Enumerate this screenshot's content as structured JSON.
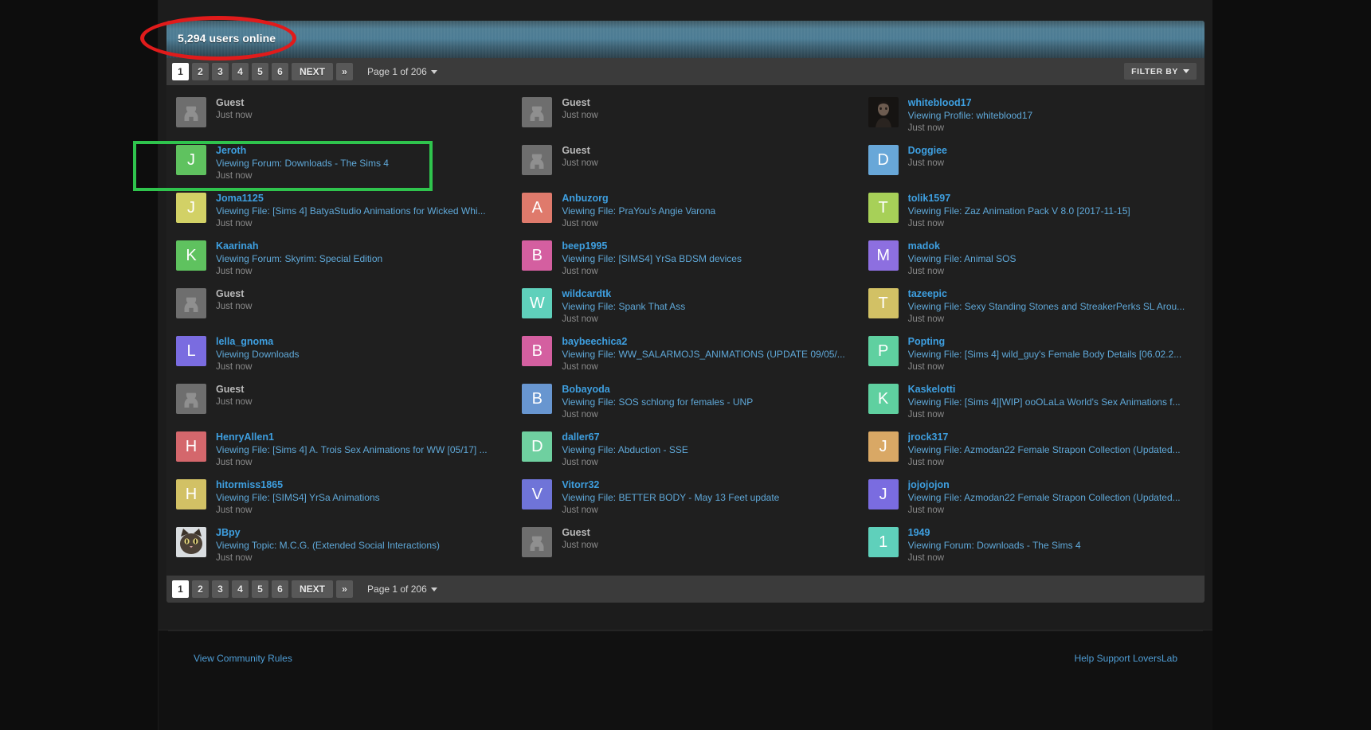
{
  "header": {
    "title": "5,294 users online"
  },
  "pagination": {
    "pages": [
      "1",
      "2",
      "3",
      "4",
      "5",
      "6"
    ],
    "active_page": "1",
    "next_label": "NEXT",
    "last_label": "»",
    "page_label": "Page 1 of 206",
    "filter_label": "FILTER BY"
  },
  "footer": {
    "left_link": "View Community Rules",
    "right_link": "Help Support LoversLab"
  },
  "colors": {
    "accent_link": "#3e9fe0",
    "header_gradient_top": "#4f7d93",
    "annotation_red": "#e01b1b",
    "annotation_green": "#2fc44d"
  },
  "users": [
    {
      "name": "Guest",
      "activity": "",
      "time": "Just now",
      "avatar_type": "guest",
      "avatar_letter": "",
      "avatar_color": "#6e6e6e",
      "is_guest": true
    },
    {
      "name": "Guest",
      "activity": "",
      "time": "Just now",
      "avatar_type": "guest",
      "avatar_letter": "",
      "avatar_color": "#6e6e6e",
      "is_guest": true
    },
    {
      "name": "whiteblood17",
      "activity": "Viewing Profile: whiteblood17",
      "time": "Just now",
      "avatar_type": "photo",
      "avatar_letter": "",
      "avatar_color": "#2b2b2b",
      "is_guest": false
    },
    {
      "name": "Jeroth",
      "activity": "Viewing Forum: Downloads - The Sims 4",
      "time": "Just now",
      "avatar_type": "letter",
      "avatar_letter": "J",
      "avatar_color": "#5fc25f",
      "is_guest": false
    },
    {
      "name": "Guest",
      "activity": "",
      "time": "Just now",
      "avatar_type": "guest",
      "avatar_letter": "",
      "avatar_color": "#6e6e6e",
      "is_guest": true
    },
    {
      "name": "Doggiee",
      "activity": "",
      "time": "Just now",
      "avatar_type": "letter",
      "avatar_letter": "D",
      "avatar_color": "#68a7d8",
      "is_guest": false
    },
    {
      "name": "Joma1125",
      "activity": "Viewing File: [Sims 4] BatyaStudio Animations for Wicked Whi...",
      "time": "Just now",
      "avatar_type": "letter",
      "avatar_letter": "J",
      "avatar_color": "#d2d166",
      "is_guest": false
    },
    {
      "name": "Anbuzorg",
      "activity": "Viewing File: PraYou's Angie Varona",
      "time": "Just now",
      "avatar_type": "letter",
      "avatar_letter": "A",
      "avatar_color": "#df7a6c",
      "is_guest": false
    },
    {
      "name": "tolik1597",
      "activity": "Viewing File: Zaz Animation Pack V 8.0 [2017-11-15]",
      "time": "Just now",
      "avatar_type": "letter",
      "avatar_letter": "T",
      "avatar_color": "#a7d058",
      "is_guest": false
    },
    {
      "name": "Kaarinah",
      "activity": "Viewing Forum: Skyrim: Special Edition",
      "time": "Just now",
      "avatar_type": "letter",
      "avatar_letter": "K",
      "avatar_color": "#5fc25f",
      "is_guest": false
    },
    {
      "name": "beep1995",
      "activity": "Viewing File: [SIMS4] YrSa BDSM devices",
      "time": "Just now",
      "avatar_type": "letter",
      "avatar_letter": "B",
      "avatar_color": "#d45fa0",
      "is_guest": false
    },
    {
      "name": "madok",
      "activity": "Viewing File: Animal SOS",
      "time": "Just now",
      "avatar_type": "letter",
      "avatar_letter": "M",
      "avatar_color": "#8d6fe0",
      "is_guest": false
    },
    {
      "name": "Guest",
      "activity": "",
      "time": "Just now",
      "avatar_type": "guest",
      "avatar_letter": "",
      "avatar_color": "#6e6e6e",
      "is_guest": true
    },
    {
      "name": "wildcardtk",
      "activity": "Viewing File: Spank That Ass",
      "time": "Just now",
      "avatar_type": "letter",
      "avatar_letter": "W",
      "avatar_color": "#5fd0bb",
      "is_guest": false
    },
    {
      "name": "tazeepic",
      "activity": "Viewing File: Sexy Standing Stones and StreakerPerks SL Arou...",
      "time": "Just now",
      "avatar_type": "letter",
      "avatar_letter": "T",
      "avatar_color": "#d2c165",
      "is_guest": false
    },
    {
      "name": "lella_gnoma",
      "activity": "Viewing Downloads",
      "time": "Just now",
      "avatar_type": "letter",
      "avatar_letter": "L",
      "avatar_color": "#7a6ce0",
      "is_guest": false
    },
    {
      "name": "baybeechica2",
      "activity": "Viewing File: WW_SALARMOJS_ANIMATIONS (UPDATE 09/05/...",
      "time": "Just now",
      "avatar_type": "letter",
      "avatar_letter": "B",
      "avatar_color": "#d45fa0",
      "is_guest": false
    },
    {
      "name": "Popting",
      "activity": "Viewing File: [Sims 4] wild_guy's Female Body Details [06.02.2...",
      "time": "Just now",
      "avatar_type": "letter",
      "avatar_letter": "P",
      "avatar_color": "#5fd0a0",
      "is_guest": false
    },
    {
      "name": "Guest",
      "activity": "",
      "time": "Just now",
      "avatar_type": "guest",
      "avatar_letter": "",
      "avatar_color": "#6e6e6e",
      "is_guest": true
    },
    {
      "name": "Bobayoda",
      "activity": "Viewing File: SOS schlong for females - UNP",
      "time": "Just now",
      "avatar_type": "letter",
      "avatar_letter": "B",
      "avatar_color": "#6896d0",
      "is_guest": false
    },
    {
      "name": "Kaskelotti",
      "activity": "Viewing File: [Sims 4][WIP] ooOLaLa World's Sex Animations f...",
      "time": "Just now",
      "avatar_type": "letter",
      "avatar_letter": "K",
      "avatar_color": "#5fd0a0",
      "is_guest": false
    },
    {
      "name": "HenryAllen1",
      "activity": "Viewing File: [Sims 4] A. Trois Sex Animations for WW [05/17] ...",
      "time": "Just now",
      "avatar_type": "letter",
      "avatar_letter": "H",
      "avatar_color": "#d4676c",
      "is_guest": false
    },
    {
      "name": "daller67",
      "activity": "Viewing File: Abduction - SSE",
      "time": "Just now",
      "avatar_type": "letter",
      "avatar_letter": "D",
      "avatar_color": "#6fd0a0",
      "is_guest": false
    },
    {
      "name": "jrock317",
      "activity": "Viewing File: Azmodan22 Female Strapon Collection (Updated...",
      "time": "Just now",
      "avatar_type": "letter",
      "avatar_letter": "J",
      "avatar_color": "#d9a865",
      "is_guest": false
    },
    {
      "name": "hitormiss1865",
      "activity": "Viewing File: [SIMS4] YrSa Animations",
      "time": "Just now",
      "avatar_type": "letter",
      "avatar_letter": "H",
      "avatar_color": "#d2c165",
      "is_guest": false
    },
    {
      "name": "Vitorr32",
      "activity": "Viewing File: BETTER BODY - May 13 Feet update",
      "time": "Just now",
      "avatar_type": "letter",
      "avatar_letter": "V",
      "avatar_color": "#6f74d8",
      "is_guest": false
    },
    {
      "name": "jojojojon",
      "activity": "Viewing File: Azmodan22 Female Strapon Collection (Updated...",
      "time": "Just now",
      "avatar_type": "letter",
      "avatar_letter": "J",
      "avatar_color": "#7a6ce0",
      "is_guest": false
    },
    {
      "name": "JBpy",
      "activity": "Viewing Topic: M.C.G. (Extended Social Interactions)",
      "time": "Just now",
      "avatar_type": "photo-cat",
      "avatar_letter": "",
      "avatar_color": "#3a3229",
      "is_guest": false
    },
    {
      "name": "Guest",
      "activity": "",
      "time": "Just now",
      "avatar_type": "guest",
      "avatar_letter": "",
      "avatar_color": "#6e6e6e",
      "is_guest": true
    },
    {
      "name": "1949",
      "activity": "Viewing Forum: Downloads - The Sims 4",
      "time": "Just now",
      "avatar_type": "letter",
      "avatar_letter": "1",
      "avatar_color": "#5fd0bb",
      "is_guest": false
    }
  ]
}
